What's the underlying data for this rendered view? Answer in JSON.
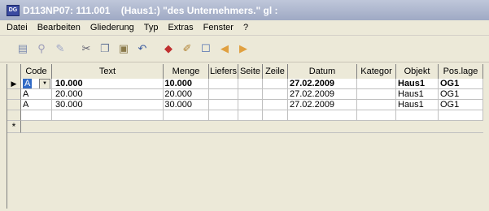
{
  "window": {
    "title": "D113NP07: 111.001    (Haus1:) \"des Unternehmers.\" gl :",
    "icon_label": "DG"
  },
  "menu": [
    "Datei",
    "Bearbeiten",
    "Gliederung",
    "Typ",
    "Extras",
    "Fenster",
    "?"
  ],
  "toolbar": [
    "new-doc-icon",
    "search-icon",
    "edit-doc-icon",
    "cut-icon",
    "copy-icon",
    "paste-icon",
    "undo-icon",
    "erase-icon",
    "pencil-icon",
    "window-icon",
    "prev-icon",
    "next-icon"
  ],
  "grid": {
    "columns": [
      "Code",
      "Text",
      "Menge",
      "Liefers",
      "Seite",
      "Zeile",
      "Datum",
      "Kategor",
      "Objekt",
      "Pos.lage"
    ],
    "rows": [
      {
        "code": "A",
        "text": "10.000",
        "menge": "10.000",
        "liefers": "",
        "seite": "",
        "zeile": "",
        "datum": "27.02.2009",
        "kategor": "",
        "objekt": "Haus1",
        "poslage": "OG1"
      },
      {
        "code": "A",
        "text": "20.000",
        "menge": "20.000",
        "liefers": "",
        "seite": "",
        "zeile": "",
        "datum": "27.02.2009",
        "kategor": "",
        "objekt": "Haus1",
        "poslage": "OG1"
      },
      {
        "code": "A",
        "text": "30.000",
        "menge": "30.000",
        "liefers": "",
        "seite": "",
        "zeile": "",
        "datum": "27.02.2009",
        "kategor": "",
        "objekt": "Haus1",
        "poslage": "OG1"
      }
    ],
    "selected_row_marker": "▶",
    "new_row_marker": "*"
  }
}
